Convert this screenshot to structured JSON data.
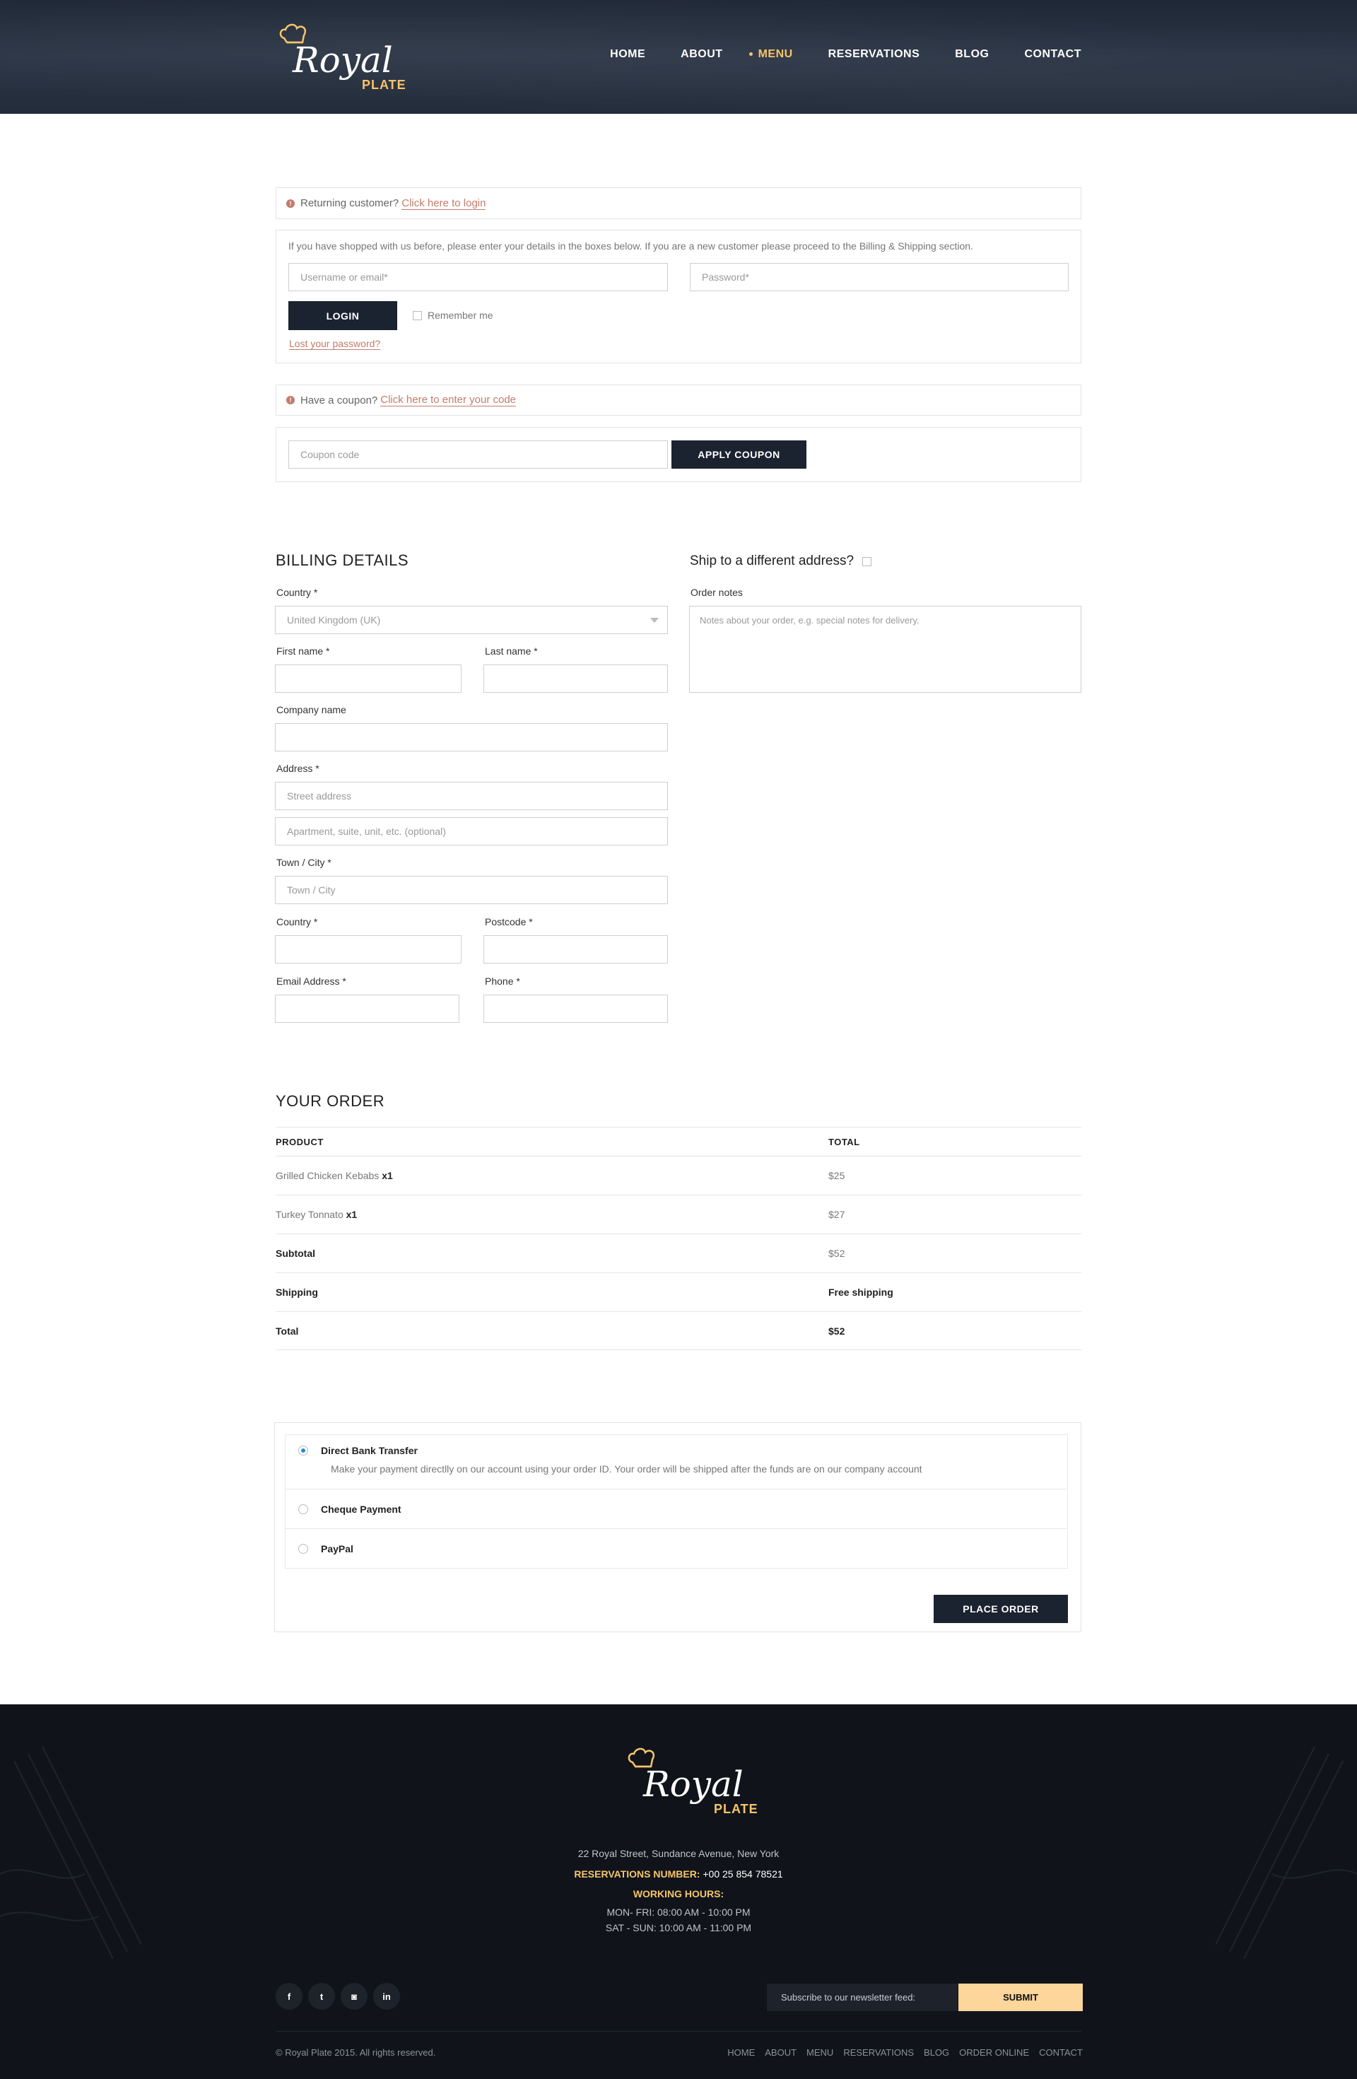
{
  "header": {
    "logo_royal": "Royal",
    "logo_plate": "PLATE",
    "nav": [
      "HOME",
      "ABOUT",
      "MENU",
      "RESERVATIONS",
      "BLOG",
      "CONTACT"
    ],
    "active_nav": "MENU"
  },
  "login_notice": {
    "text": "Returning customer?",
    "link": "Click here to login"
  },
  "login": {
    "intro": "If you have shopped with us before, please enter your details in the boxes below. If you are a new customer please proceed to the Billing & Shipping section.",
    "username_placeholder": "Username or email*",
    "password_placeholder": "Password*",
    "login_button": "LOGIN",
    "remember_me": "Remember me",
    "lost_password": "Lost your password?"
  },
  "coupon_notice": {
    "text": "Have a coupon?",
    "link": "Click here to enter your code"
  },
  "coupon": {
    "placeholder": "Coupon code",
    "button": "APPLY COUPON"
  },
  "billing": {
    "title": "BILLING DETAILS",
    "country_label": "Country *",
    "country_value": "United Kingdom (UK)",
    "first_name_label": "First name *",
    "last_name_label": "Last name *",
    "company_label": "Company name",
    "address_label": "Address *",
    "street_placeholder": "Street address",
    "apartment_placeholder": "Apartment, suite, unit, etc. (optional)",
    "town_label": "Town / City *",
    "town_placeholder": "Town / City",
    "country2_label": "Country *",
    "postcode_label": "Postcode *",
    "email_label": "Email Address *",
    "phone_label": "Phone *"
  },
  "shipping": {
    "title": "Ship to a different address?",
    "notes_label": "Order notes",
    "notes_placeholder": "Notes about your order, e.g. special notes for delivery."
  },
  "order": {
    "title": "YOUR ORDER",
    "col_product": "PRODUCT",
    "col_total": "TOTAL",
    "items": [
      {
        "name": "Grilled Chicken Kebabs",
        "qty": "x1",
        "total": "$25"
      },
      {
        "name": "Turkey Tonnato",
        "qty": "x1",
        "total": "$27"
      }
    ],
    "subtotal_label": "Subtotal",
    "subtotal_value": "$52",
    "shipping_label": "Shipping",
    "shipping_value": "Free shipping",
    "total_label": "Total",
    "total_value": "$52"
  },
  "payment": {
    "options": [
      "Direct Bank Transfer",
      "Cheque Payment",
      "PayPal"
    ],
    "selected": "Direct Bank Transfer",
    "bank_description": "Make your payment directlly on our account using your order ID. Your order will be shipped after the funds are on our company account",
    "place_order": "PLACE ORDER"
  },
  "footer": {
    "address": "22 Royal Street, Sundance Avenue, New York",
    "reservations_label": "RESERVATIONS NUMBER:",
    "reservations_number": "+00 25 854 78521",
    "hours_label": "WORKING HOURS:",
    "hours_weekday": "MON- FRI: 08:00 AM - 10:00 PM",
    "hours_weekend": "SAT - SUN: 10:00 AM - 11:00 PM",
    "social_icons": [
      "facebook-icon",
      "twitter-icon",
      "instagram-icon",
      "linkedin-icon"
    ],
    "newsletter_placeholder": "Subscribe to our newsletter feed:",
    "submit": "SUBMIT",
    "copyright": "© Royal Plate 2015. All rights reserved.",
    "nav": [
      "HOME",
      "ABOUT",
      "MENU",
      "RESERVATIONS",
      "BLOG",
      "ORDER ONLINE",
      "CONTACT"
    ]
  },
  "colors": {
    "accent": "#f6c56a",
    "dark": "#1b2230",
    "link": "#c27c6b",
    "footer_bg": "#10131a"
  }
}
